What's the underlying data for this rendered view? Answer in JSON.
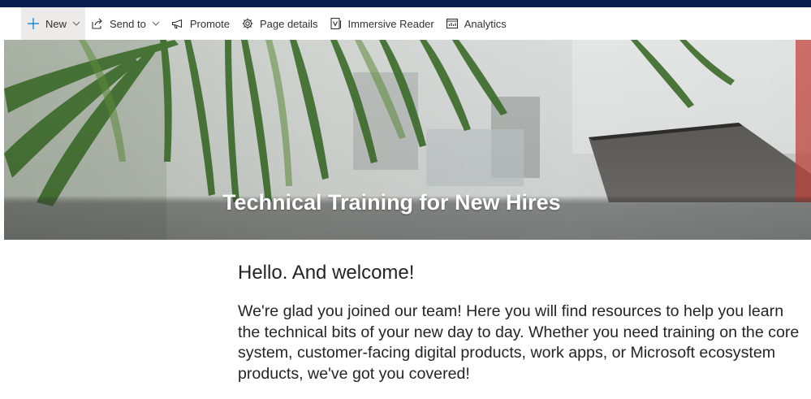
{
  "commandbar": {
    "items": [
      {
        "label": "New",
        "icon": "plus-icon",
        "dropdown": true
      },
      {
        "label": "Send to",
        "icon": "share-icon",
        "dropdown": true
      },
      {
        "label": "Promote",
        "icon": "megaphone-icon",
        "dropdown": false
      },
      {
        "label": "Page details",
        "icon": "gear-icon",
        "dropdown": false
      },
      {
        "label": "Immersive Reader",
        "icon": "immersive-reader-icon",
        "dropdown": false
      },
      {
        "label": "Analytics",
        "icon": "analytics-icon",
        "dropdown": false
      }
    ]
  },
  "hero": {
    "title": "Technical Training for New Hires"
  },
  "content": {
    "greeting": "Hello. And welcome!",
    "intro": "We're glad you joined our team! Here you will find resources to help you learn the technical bits of your new day to day. Whether you need training on the core system, customer-facing digital products, work apps, or Microsoft ecosystem products, we've got you covered!"
  },
  "colors": {
    "topbar": "#0b1c4f",
    "accent": "#0078d4",
    "active_bg": "#edebe9"
  }
}
